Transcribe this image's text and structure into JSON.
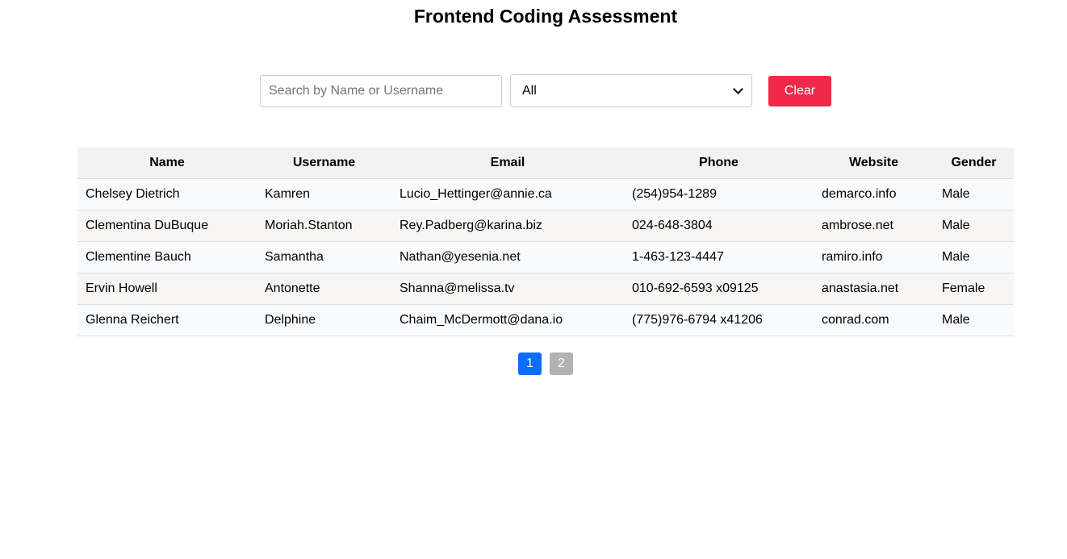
{
  "header": {
    "title": "Frontend Coding Assessment"
  },
  "controls": {
    "search_placeholder": "Search by Name or Username",
    "search_value": "",
    "gender_select_value": "All",
    "clear_label": "Clear"
  },
  "table": {
    "columns": [
      "Name",
      "Username",
      "Email",
      "Phone",
      "Website",
      "Gender"
    ],
    "rows": [
      [
        "Chelsey Dietrich",
        "Kamren",
        "Lucio_Hettinger@annie.ca",
        "(254)954-1289",
        "demarco.info",
        "Male"
      ],
      [
        "Clementina DuBuque",
        "Moriah.Stanton",
        "Rey.Padberg@karina.biz",
        "024-648-3804",
        "ambrose.net",
        "Male"
      ],
      [
        "Clementine Bauch",
        "Samantha",
        "Nathan@yesenia.net",
        "1-463-123-4447",
        "ramiro.info",
        "Male"
      ],
      [
        "Ervin Howell",
        "Antonette",
        "Shanna@melissa.tv",
        "010-692-6593 x09125",
        "anastasia.net",
        "Female"
      ],
      [
        "Glenna Reichert",
        "Delphine",
        "Chaim_McDermott@dana.io",
        "(775)976-6794 x41206",
        "conrad.com",
        "Male"
      ]
    ]
  },
  "pagination": {
    "pages": [
      "1",
      "2"
    ],
    "current": "1"
  },
  "colors": {
    "clear_button": "#f0284a",
    "active_page": "#0d6efd",
    "inactive_page": "#b3b1b1",
    "header_bg": "#f2f2f2"
  }
}
